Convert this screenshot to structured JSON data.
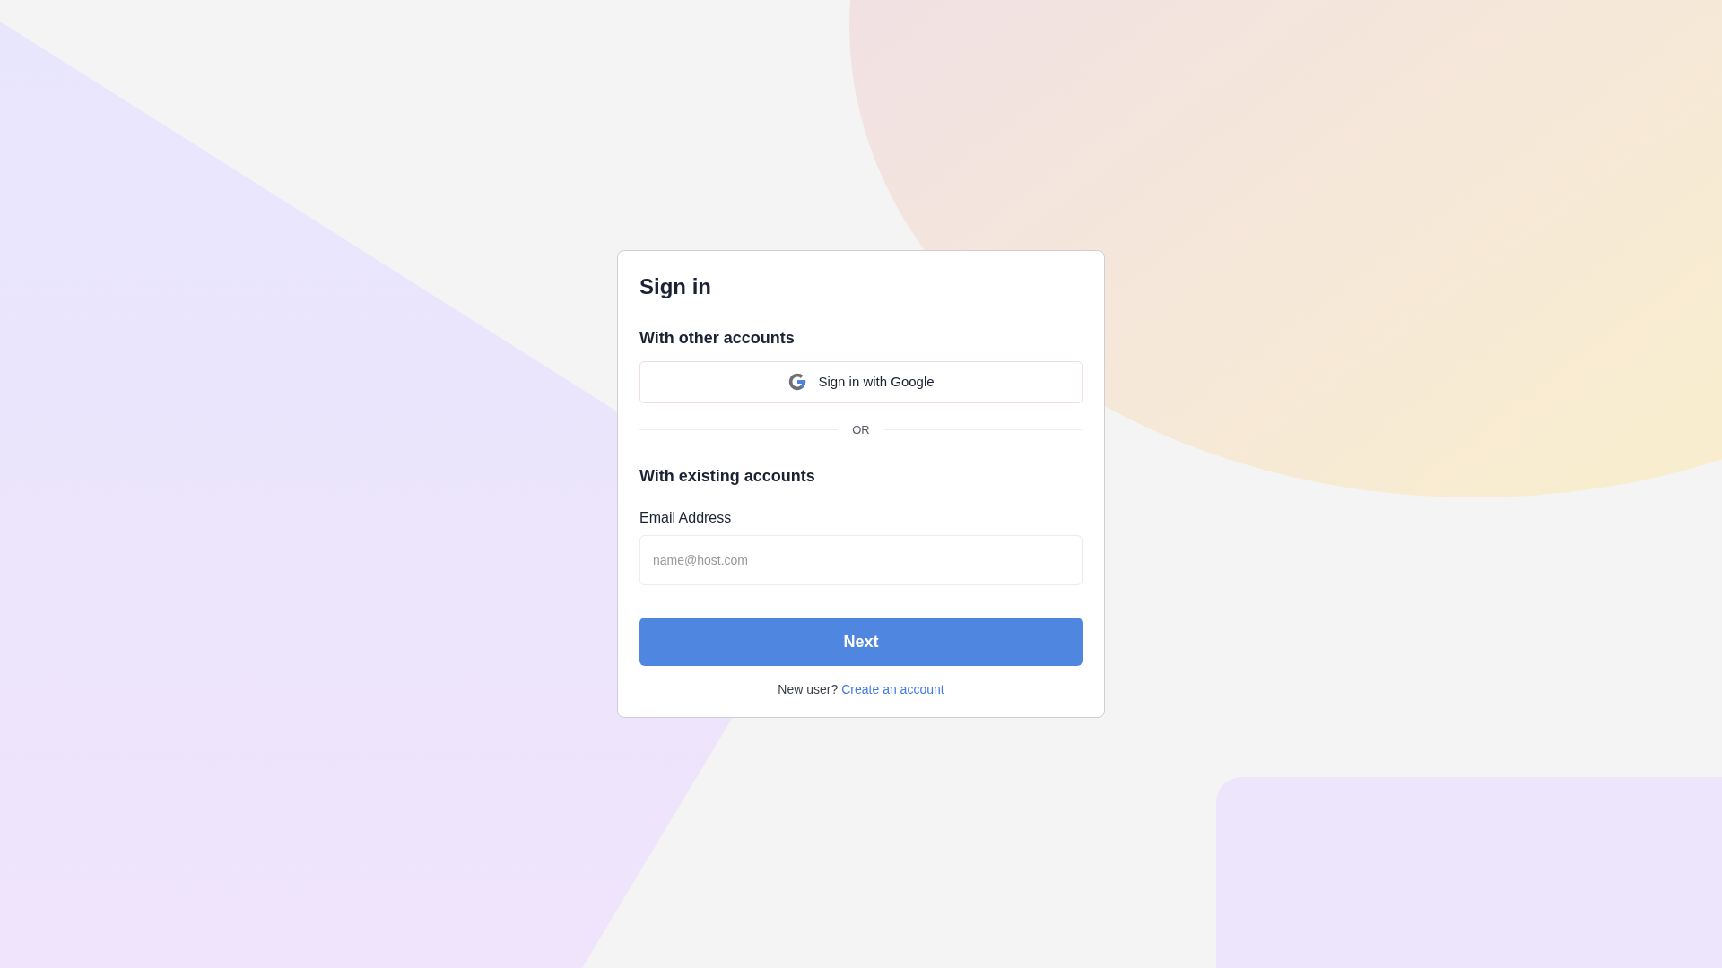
{
  "title": "Sign in",
  "other_accounts": {
    "heading": "With other accounts",
    "google_button": "Sign in with Google"
  },
  "divider": "OR",
  "existing_accounts": {
    "heading": "With existing accounts",
    "email_label": "Email Address",
    "email_placeholder": "name@host.com"
  },
  "next_button": "Next",
  "footer": {
    "prompt": "New user?",
    "link": "Create an account"
  }
}
